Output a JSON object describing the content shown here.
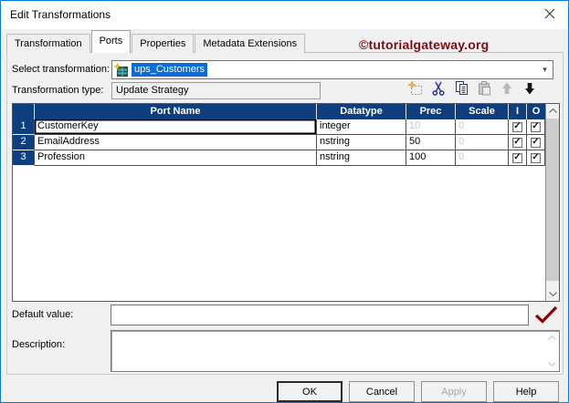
{
  "window": {
    "title": "Edit Transformations"
  },
  "watermark": {
    "text": "©tutorialgateway.org"
  },
  "tabs": [
    {
      "label": "Transformation"
    },
    {
      "label": "Ports"
    },
    {
      "label": "Properties"
    },
    {
      "label": "Metadata Extensions"
    }
  ],
  "active_tab": "Ports",
  "selectors": {
    "select_transformation_label": "Select transformation:",
    "select_transformation_value": "ups_Customers",
    "dropdown_glyph": "▾",
    "transformation_type_label": "Transformation type:",
    "transformation_type_value": "Update Strategy"
  },
  "toolbar": {
    "icons": [
      "new-port",
      "cut",
      "copy",
      "paste",
      "move-up",
      "move-down"
    ]
  },
  "ports_table": {
    "columns": [
      "",
      "Port Name",
      "Datatype",
      "Prec",
      "Scale",
      "I",
      "O"
    ],
    "check_glyph": "✓",
    "rows": [
      {
        "num": "1",
        "port_name": "CustomerKey",
        "datatype": "integer",
        "prec": "10",
        "scale": "0",
        "prec_disabled": true,
        "scale_disabled": true,
        "input": true,
        "output": true,
        "selected": true
      },
      {
        "num": "2",
        "port_name": "EmailAddress",
        "datatype": "nstring",
        "prec": "50",
        "scale": "0",
        "prec_disabled": false,
        "scale_disabled": true,
        "input": true,
        "output": true,
        "selected": false
      },
      {
        "num": "3",
        "port_name": "Profession",
        "datatype": "nstring",
        "prec": "100",
        "scale": "0",
        "prec_disabled": false,
        "scale_disabled": true,
        "input": true,
        "output": true,
        "selected": false
      }
    ]
  },
  "fields": {
    "default_value_label": "Default value:",
    "default_value": "",
    "description_label": "Description:",
    "description": ""
  },
  "buttons": [
    {
      "label": "OK",
      "default": true,
      "disabled": false
    },
    {
      "label": "Cancel",
      "default": false,
      "disabled": false
    },
    {
      "label": "Apply",
      "default": false,
      "disabled": true
    },
    {
      "label": "Help",
      "default": false,
      "disabled": false
    }
  ],
  "colors": {
    "accent_border": "#0078d7",
    "grid_header_blue": "#0e3e7e",
    "selection_blue": "#0a6cd6",
    "watermark_red": "#7d0a10",
    "check_red": "#8b0000"
  }
}
